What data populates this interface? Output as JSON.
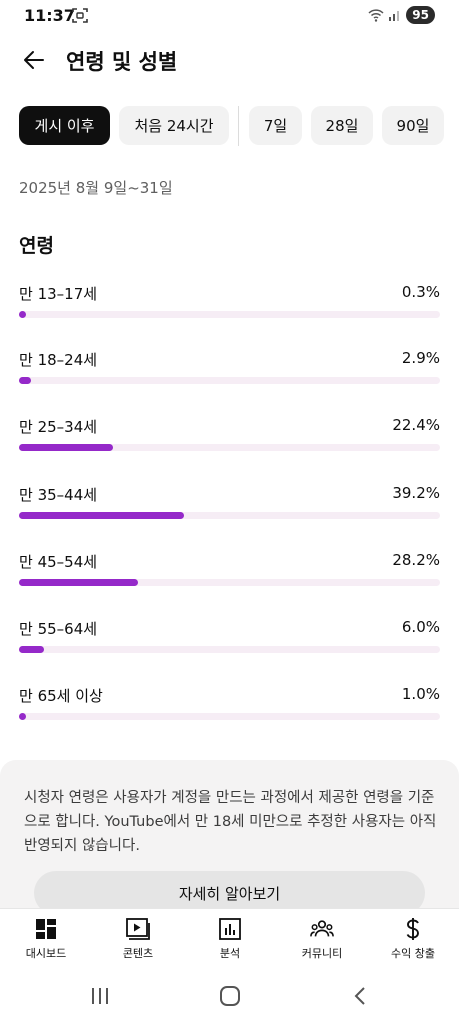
{
  "status": {
    "time": "11:37",
    "battery": "95"
  },
  "header": {
    "title": "연령 및 성별"
  },
  "chips": [
    {
      "label": "게시 이후",
      "active": true
    },
    {
      "label": "처음 24시간",
      "active": false
    },
    {
      "label": "7일",
      "active": false
    },
    {
      "label": "28일",
      "active": false
    },
    {
      "label": "90일",
      "active": false
    }
  ],
  "date_range": "2025년 8월 9일~31일",
  "age_section": {
    "title": "연령",
    "rows": [
      {
        "label": "만 13–17세",
        "percent": "0.3%",
        "value": 0.3
      },
      {
        "label": "만 18–24세",
        "percent": "2.9%",
        "value": 2.9
      },
      {
        "label": "만 25–34세",
        "percent": "22.4%",
        "value": 22.4
      },
      {
        "label": "만 35–44세",
        "percent": "39.2%",
        "value": 39.2
      },
      {
        "label": "만 45–54세",
        "percent": "28.2%",
        "value": 28.2
      },
      {
        "label": "만 55–64세",
        "percent": "6.0%",
        "value": 6.0
      },
      {
        "label": "만 65세 이상",
        "percent": "1.0%",
        "value": 1.0
      }
    ],
    "bar_color": "#9529c9",
    "track_color": "#f6edf5"
  },
  "info": {
    "text": "시청자 연령은 사용자가 계정을 만드는 과정에서 제공한 연령을 기준으로 합니다. YouTube에서 만 18세 미만으로 추정한 사용자는 아직 반영되지 않습니다.",
    "button": "자세히 알아보기"
  },
  "bottom_nav": [
    {
      "label": "대시보드",
      "icon": "dashboard-icon"
    },
    {
      "label": "콘텐츠",
      "icon": "content-icon"
    },
    {
      "label": "분석",
      "icon": "analytics-icon"
    },
    {
      "label": "커뮤니티",
      "icon": "community-icon"
    },
    {
      "label": "수익 창출",
      "icon": "earn-icon"
    }
  ]
}
